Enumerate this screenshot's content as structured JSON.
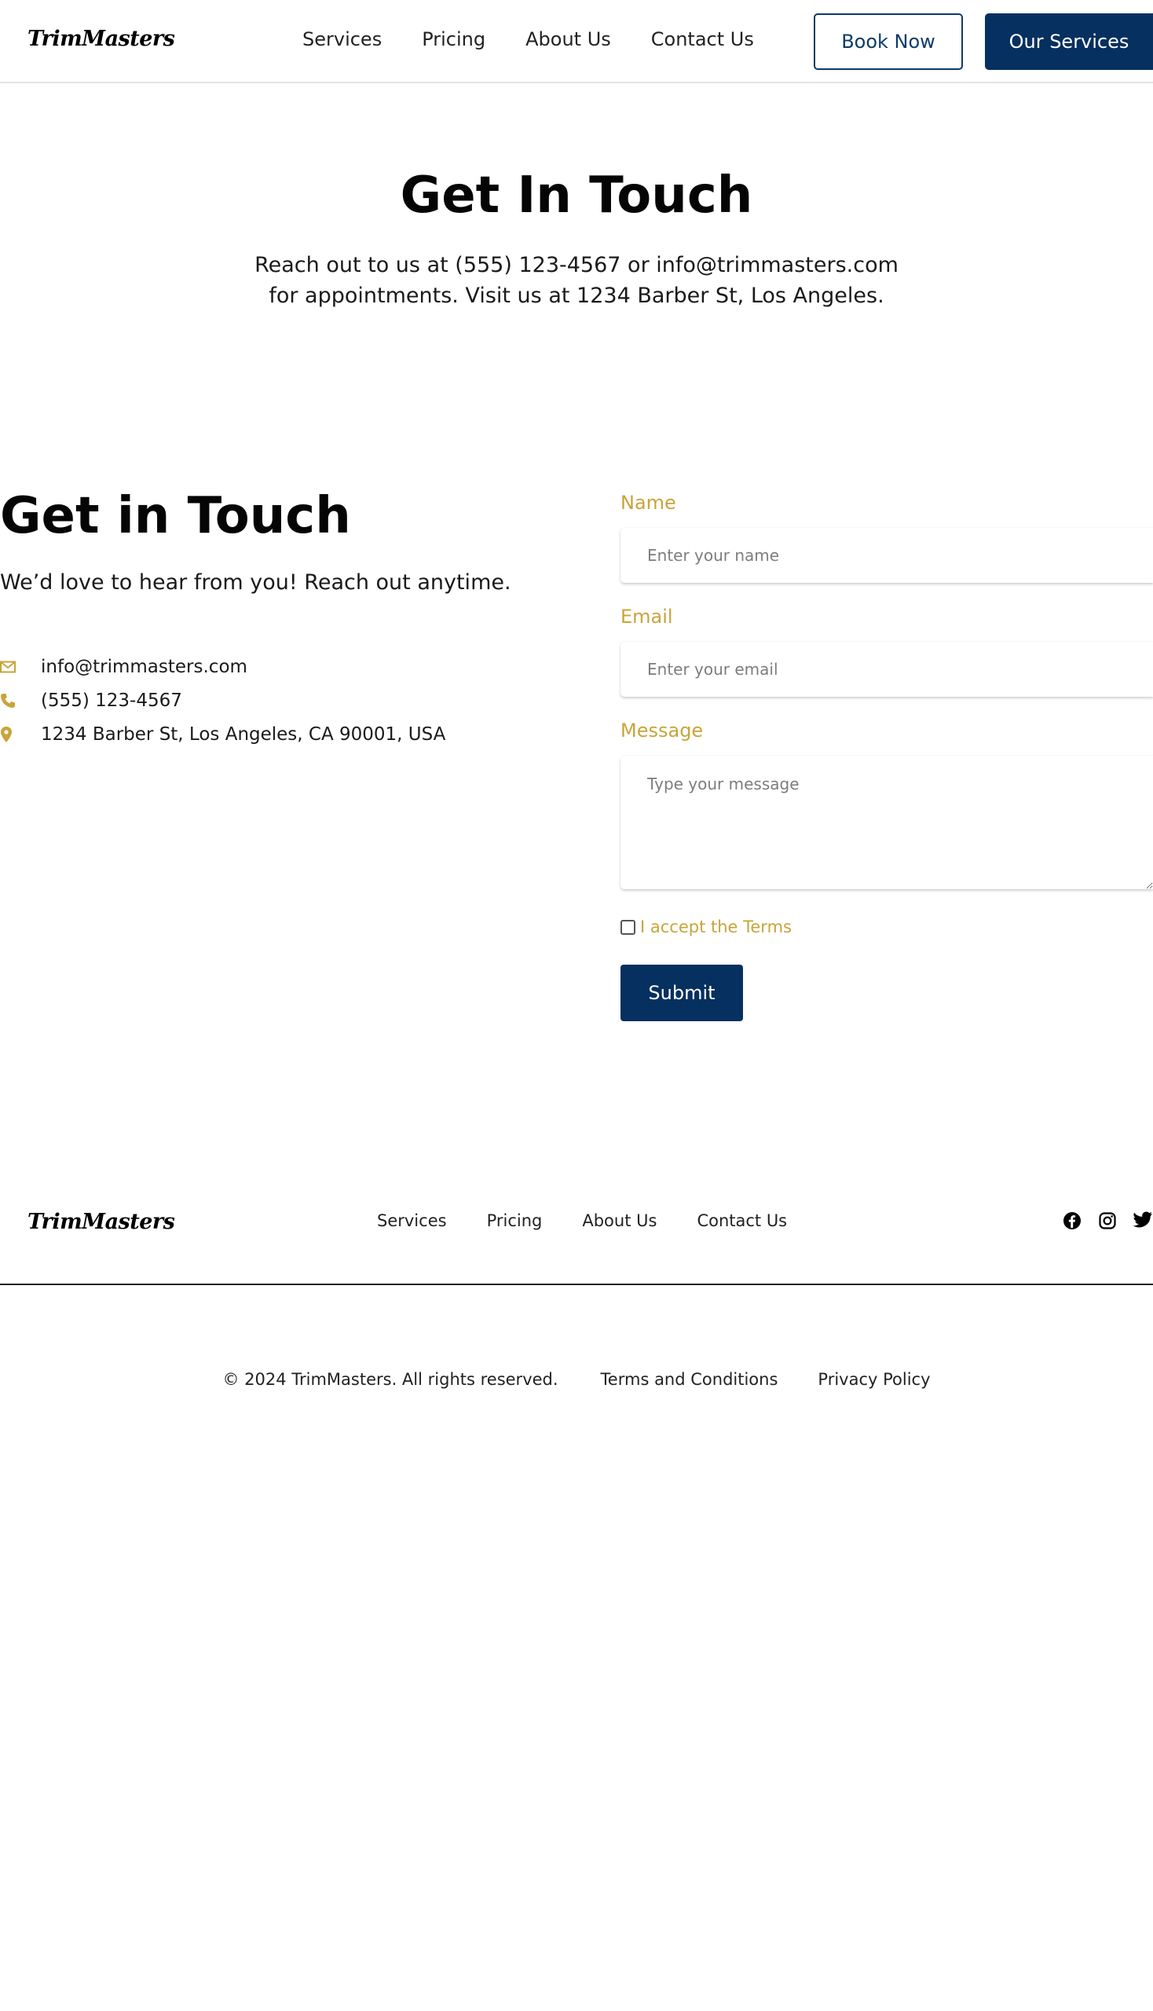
{
  "header": {
    "logo": "TrimMasters",
    "nav": [
      "Services",
      "Pricing",
      "About Us",
      "Contact Us"
    ],
    "book_label": "Book Now",
    "services_label": "Our Services"
  },
  "hero": {
    "title": "Get In Touch",
    "text": "Reach out to us at (555) 123-4567 or info@trimmasters.com for appointments. Visit us at 1234 Barber St, Los Angeles."
  },
  "contact": {
    "title": "Get in Touch",
    "subtitle": "We’d love to hear from you! Reach out anytime.",
    "email": "info@trimmasters.com",
    "phone": "(555) 123-4567",
    "address": "1234 Barber St, Los Angeles, CA 90001, USA",
    "icons": [
      "envelope-icon",
      "phone-icon",
      "map-pin-icon"
    ],
    "accent_color": "#c9a43a"
  },
  "form": {
    "name_label": "Name",
    "name_placeholder": "Enter your name",
    "email_label": "Email",
    "email_placeholder": "Enter your email",
    "message_label": "Message",
    "message_placeholder": "Type your message",
    "terms_label": "I accept the Terms",
    "submit_label": "Submit",
    "button_color": "#06305f"
  },
  "footer": {
    "logo": "TrimMasters",
    "nav": [
      "Services",
      "Pricing",
      "About Us",
      "Contact Us"
    ],
    "social_icons": [
      "facebook-icon",
      "instagram-icon",
      "twitter-icon"
    ],
    "copyright": "© 2024 TrimMasters. All rights reserved.",
    "terms_link": "Terms and Conditions",
    "privacy_link": "Privacy Policy"
  }
}
